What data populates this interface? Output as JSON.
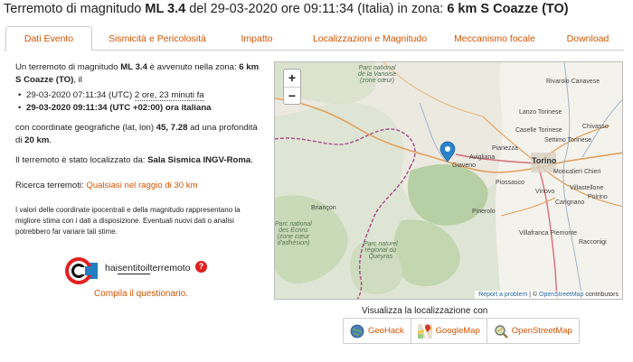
{
  "header": {
    "title_prefix": "Terremoto di magnitudo ",
    "magnitude": "ML 3.4",
    "title_mid1": " del 29-03-2020 ore 09:11:34 (Italia) in zona: ",
    "zone": "6 km S Coazze (TO)"
  },
  "tabs": [
    {
      "label": "Dati Evento",
      "active": true
    },
    {
      "label": "Sismicità e Pericolosità",
      "active": false
    },
    {
      "label": "Impatto",
      "active": false
    },
    {
      "label": "Localizzazioni e Magnitudo",
      "active": false
    },
    {
      "label": "Meccanismo focale",
      "active": false
    },
    {
      "label": "Download",
      "active": false
    }
  ],
  "event": {
    "intro_a": "Un terremoto di magnitudo ",
    "intro_mag": "ML 3.4",
    "intro_b": " è avvenuto nella zona: ",
    "intro_zone": "6 km S Coazze (TO)",
    "intro_c": ", il",
    "utc_time": "29-03-2020 07:11:34 (UTC)",
    "utc_ago": "2 ore, 23 minuti fa",
    "local_time": "29-03-2020 09:11:34 (UTC +02:00) ora italiana",
    "coords_a": "con coordinate geografiche (lat, lon) ",
    "coords_val": "45, 7.28",
    "coords_b": " ad una profondità di ",
    "depth": "20 km",
    "coords_c": ".",
    "located_a": "Il terremoto è stato localizzato da: ",
    "located_by": "Sala Sismica INGV-Roma",
    "located_c": ".",
    "search_label": "Ricerca terremoti: ",
    "search_link": "Qualsiasi nel raggio di 30 km",
    "note": "I valori delle coordinate ipocentrali e della magnitudo rappresentano la migliore stima con i dati a disposizione. Eventuali nuovi dati o analisi potrebbero far variare tali stime."
  },
  "hsit": {
    "text_a": "hai",
    "text_b": "sentito",
    "text_c": "il",
    "text_d": "terremoto",
    "q": "?",
    "compila": "Compila il questionario."
  },
  "map": {
    "zoom_in": "+",
    "zoom_out": "−",
    "attr_a": "Report a problem",
    "attr_b": " | © ",
    "attr_c": "OpenStreetMap",
    "attr_d": " contributors",
    "labels": {
      "park_vanoise": "Parc national\nde la Vanoise\n(zone cœur)",
      "rivarolo": "Rivarolo Canavese",
      "lanzo": "Lanzo Torinese",
      "caselle": "Caselle Torinese",
      "settimo": "Settimo Torinese",
      "chivasso": "Chivasso",
      "pianezza": "Pianezza",
      "avigliana": "Avigliana",
      "giaveno": "Giaveno",
      "torino": "Torino",
      "moncalieri": "Moncalieri",
      "chieri": "Chieri",
      "piossasco": "Piossasco",
      "vinovo": "Vinovo",
      "carignano": "Carignano",
      "pinerolo": "Pinerolo",
      "villafranca": "Villafranca Piemonte",
      "briancon": "Briançon",
      "ecrins": "Parc national\ndes Écrins\n(zone cœur\nd'adhésion)",
      "queyras": "Parc naturel\nrégional du\nQueyras",
      "villastellone": "Villastellone",
      "poirino": "Poirino",
      "racconigi": "Racconigi"
    }
  },
  "links": {
    "viz_label": "Visualizza la localizzazione con",
    "geohack": "GeoHack",
    "googlemap": "GoogleMap",
    "osm": "OpenStreetMap"
  },
  "colors": {
    "accent": "#d35400",
    "tab_border": "#cfcfcf",
    "map_pin": "#2b82cb"
  }
}
